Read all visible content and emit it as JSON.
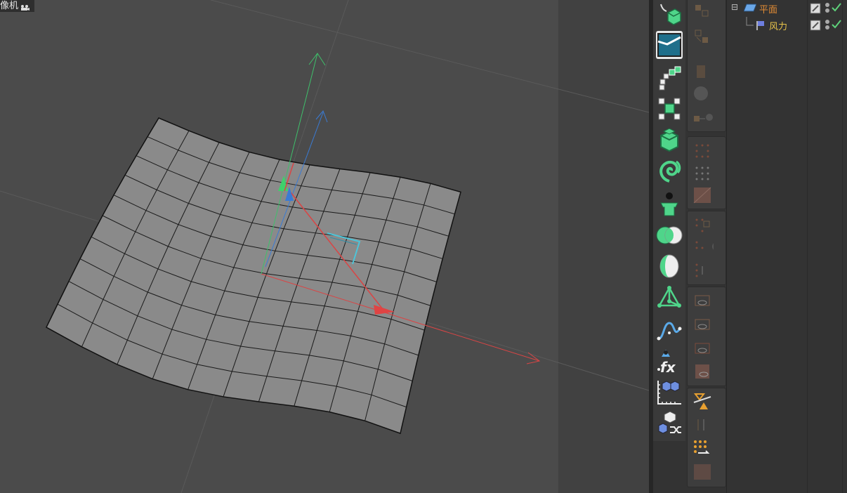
{
  "viewport": {
    "camera_label": "像机",
    "camera_icon": "camera-icon",
    "background": "#4b4b4b",
    "axis_colors": {
      "x": "#d94545",
      "y": "#3fc06b",
      "z": "#3a7bd5"
    }
  },
  "toolbar": {
    "items": [
      {
        "icon": "bend-deformer-cube-icon"
      },
      {
        "icon": "voronoi-fracture-icon"
      },
      {
        "icon": "array-cloner-icon"
      },
      {
        "icon": "cloner-icon"
      },
      {
        "icon": "extrude-cube-icon"
      },
      {
        "icon": "spiral-effector-icon"
      },
      {
        "icon": "character-icon"
      },
      {
        "icon": "boolean-icon"
      },
      {
        "icon": "sphere-shading-icon"
      },
      {
        "icon": "tetrahedron-icon"
      },
      {
        "icon": "spline-icon"
      },
      {
        "icon": "xpresso-fx-icon"
      },
      {
        "icon": "mograph-matrix-icon"
      },
      {
        "icon": "random-effector-icon"
      }
    ]
  },
  "object_manager": {
    "objects": [
      {
        "name": "平面",
        "icon": "plane-icon",
        "color": "#e28b34",
        "level": 0,
        "expander": "⊟"
      },
      {
        "name": "风力",
        "icon": "wind-flag-icon",
        "color": "#e8c34a",
        "level": 1
      }
    ],
    "enabled_check_color": "#5ed27a"
  }
}
